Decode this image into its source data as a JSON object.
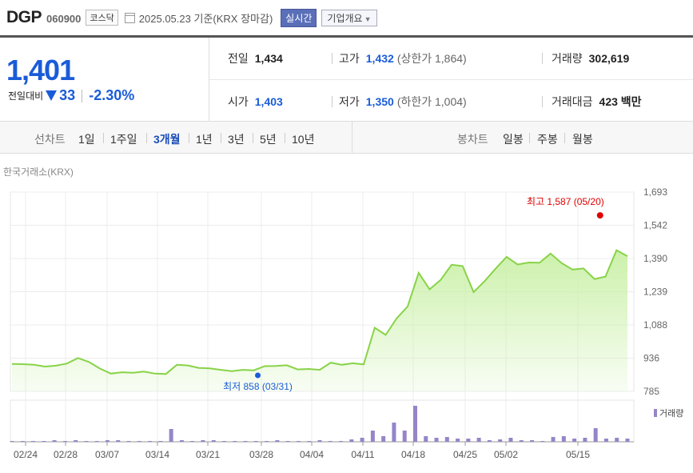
{
  "header": {
    "name": "DGP",
    "code": "060900",
    "market": "코스닥",
    "date": "2025.05.23",
    "basis": "기준(KRX 장마감)",
    "realtime_button": "실시간",
    "overview_button": "기업개요"
  },
  "quote": {
    "price": "1,401",
    "change_label": "전일대비",
    "change": "33",
    "change_rate": "-2.30%",
    "prev_close_label": "전일",
    "prev_close": "1,434",
    "open_label": "시가",
    "open": "1,403",
    "high_label": "고가",
    "high": "1,432",
    "upper_limit": "(상한가 1,864)",
    "low_label": "저가",
    "low": "1,350",
    "lower_limit": "(하한가 1,004)",
    "volume_label": "거래량",
    "volume": "302,619",
    "amount_label": "거래대금",
    "amount": "423 백만"
  },
  "tabs": {
    "line_label": "선차트",
    "periods": [
      "1일",
      "1주일",
      "3개월",
      "1년",
      "3년",
      "5년",
      "10년"
    ],
    "selected": "3개월",
    "candle_label": "봉차트",
    "candles": [
      "일봉",
      "주봉",
      "월봉"
    ]
  },
  "exchange": "한국거래소(KRX)",
  "colors": {
    "price_blue": "#1a5cd8",
    "line_green": "#88d348",
    "area_green": "#c9f0a6",
    "volume_purple": "#9585c8",
    "high_red": "#e00000",
    "low_blue": "#1a5cd8"
  },
  "chart_data": {
    "type": "area",
    "y_ticks": [
      "1,693",
      "1,542",
      "1,390",
      "1,239",
      "1,088",
      "936",
      "785"
    ],
    "ylim": [
      785,
      1693
    ],
    "x_tick_labels": [
      "02/24",
      "02/28",
      "03/07",
      "03/14",
      "03/21",
      "03/28",
      "04/04",
      "04/11",
      "04/18",
      "04/25",
      "05/02",
      "05/15"
    ],
    "series": [
      {
        "values": [
          910,
          909,
          906,
          898,
          902,
          912,
          937,
          919,
          889,
          866,
          872,
          870,
          875,
          866,
          864,
          906,
          903,
          892,
          890,
          883,
          877,
          883,
          881,
          900,
          901,
          904,
          885,
          887,
          883,
          916,
          906,
          913,
          908,
          1075,
          1042,
          1118,
          1172,
          1325,
          1250,
          1293,
          1362,
          1356,
          1237,
          1287,
          1344,
          1398,
          1363,
          1372,
          1371,
          1413,
          1370,
          1340,
          1345,
          1297,
          1308,
          1428,
          1401
        ]
      }
    ],
    "annotations": [
      {
        "label": "최고 1,587 (05/20)",
        "index": 53,
        "value": 1587
      },
      {
        "label": "최저 858 (03/31)",
        "index": 22,
        "value": 858
      }
    ],
    "volume_legend": "거래량",
    "volume": [
      1,
      0,
      0,
      0,
      2,
      0,
      2,
      1,
      0,
      2,
      2,
      0,
      0,
      0,
      0,
      16,
      2,
      0,
      2,
      2,
      0,
      0,
      0,
      0,
      0,
      2,
      0,
      0,
      0,
      2,
      0,
      0,
      3,
      5,
      14,
      7,
      24,
      14,
      45,
      7,
      5,
      6,
      4,
      4,
      5,
      2,
      3,
      5,
      2,
      2,
      0,
      6,
      7,
      4,
      5,
      17,
      4,
      5,
      4
    ],
    "volume_max": 45
  }
}
